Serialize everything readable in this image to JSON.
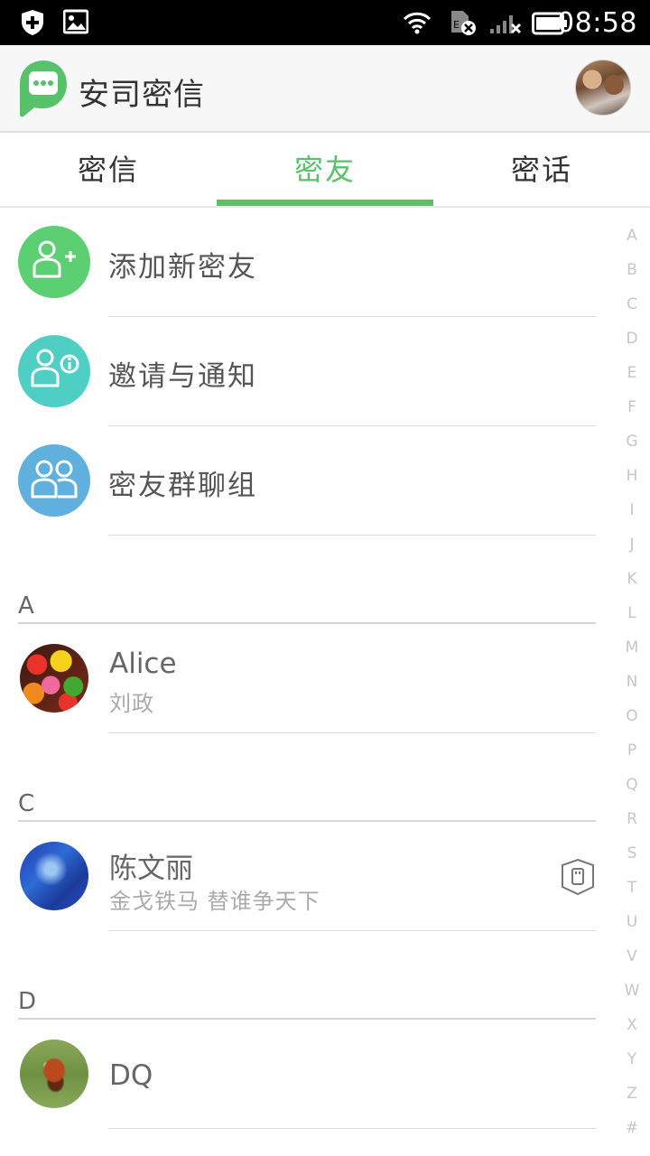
{
  "status_bar": {
    "time": "08:58",
    "icons": [
      "shield-plus-icon",
      "image-icon",
      "wifi-icon",
      "sim-error-icon",
      "signal-off-icon",
      "battery-icon"
    ]
  },
  "app_bar": {
    "title": "安司密信",
    "logo": "chat-bubble-logo-icon",
    "profile": "profile-avatar"
  },
  "tabs": [
    {
      "label": "密信",
      "active": false
    },
    {
      "label": "密友",
      "active": true
    },
    {
      "label": "密话",
      "active": false
    }
  ],
  "features": [
    {
      "label": "添加新密友",
      "icon": "add-person-icon",
      "color": "#5ccf72"
    },
    {
      "label": "邀请与通知",
      "icon": "person-info-icon",
      "color": "#4fcfc4"
    },
    {
      "label": "密友群聊组",
      "icon": "group-icon",
      "color": "#5fb0dc"
    }
  ],
  "sections": [
    {
      "letter": "A",
      "contacts": [
        {
          "name": "Alice",
          "subtitle": "刘政",
          "avatar": "candy-avatar"
        }
      ]
    },
    {
      "letter": "C",
      "contacts": [
        {
          "name": "陈文丽",
          "subtitle": "金戈铁马 替谁争天下",
          "avatar": "blue-avatar",
          "badge": "secure-device-icon"
        }
      ]
    },
    {
      "letter": "D",
      "contacts": [
        {
          "name": "DQ",
          "subtitle": "",
          "avatar": "red-panda-avatar"
        }
      ]
    }
  ],
  "alphabet_index": [
    "A",
    "B",
    "C",
    "D",
    "E",
    "F",
    "G",
    "H",
    "I",
    "J",
    "K",
    "L",
    "M",
    "N",
    "O",
    "P",
    "Q",
    "R",
    "S",
    "T",
    "U",
    "V",
    "W",
    "X",
    "Y",
    "Z",
    "#"
  ],
  "colors": {
    "accent": "#58c26a",
    "text_primary": "#333333",
    "text_secondary": "#aaaaaa"
  }
}
